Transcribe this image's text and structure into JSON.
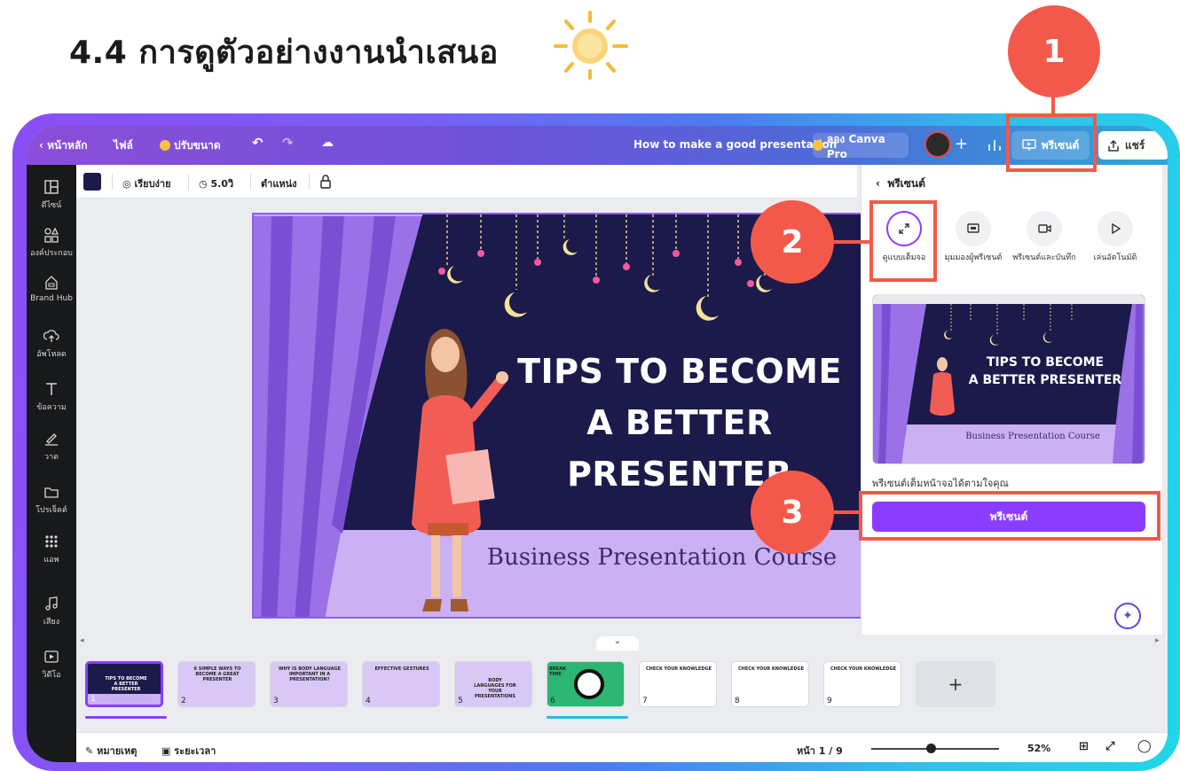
{
  "heading": "4.4  การดูตัวอย่างงานนำเสนอ",
  "callouts": [
    "1",
    "2",
    "3"
  ],
  "topbar": {
    "back": "หน้าหลัก",
    "file": "ไฟล์",
    "resize": "ปรับขนาด",
    "doc_title": "How to make a good presentation",
    "pro": "ลอง Canva Pro",
    "present": "พรีเซนต์",
    "share": "แชร์"
  },
  "sidebar": [
    "ดีไซน์",
    "องค์ประกอบ",
    "Brand Hub",
    "อัพโหลด",
    "ข้อความ",
    "วาด",
    "โปรเจ็คต์",
    "แอพ",
    "เสียง",
    "วิดีโอ"
  ],
  "toolbar": {
    "easy": "เรียบง่าย",
    "duration": "5.0วิ",
    "position": "ตำแหน่ง"
  },
  "slide": {
    "title_line1": "TIPS TO BECOME",
    "title_line2": "A BETTER PRESENTER",
    "subtitle": "Business Presentation Course"
  },
  "panel": {
    "back_title": "พรีเซนต์",
    "options": [
      {
        "label": "ดูแบบเต็มจอ",
        "icon": "expand-icon",
        "selected": true
      },
      {
        "label": "มุมมองผู้พรีเซนต์",
        "icon": "presenter-view-icon",
        "selected": false
      },
      {
        "label": "พรีเซนต์และบันทึก",
        "icon": "record-icon",
        "selected": false
      },
      {
        "label": "เล่นอัตโนมัติ",
        "icon": "play-icon",
        "selected": false
      }
    ],
    "thumb_title1": "TIPS TO BECOME",
    "thumb_title2": "A BETTER PRESENTER",
    "thumb_sub": "Business Presentation Course",
    "note": "พรีเซนต์เต็มหน้าจอได้ตามใจคุณ",
    "button": "พรีเซนต์"
  },
  "pages": [
    {
      "num": "1",
      "label": ""
    },
    {
      "num": "2",
      "label": "6 SIMPLE WAYS TO BECOME A GREAT PRESENTER"
    },
    {
      "num": "3",
      "label": "WHY IS BODY LANGUAGE IMPORTANT IN A PRESENTATION?"
    },
    {
      "num": "4",
      "label": "EFFECTIVE GESTURES"
    },
    {
      "num": "5",
      "label": "BODY LANGUAGES FOR YOUR PRESENTATIONS"
    },
    {
      "num": "6",
      "label": "BREAK TIME"
    },
    {
      "num": "7",
      "label": "CHECK YOUR KNOWLEDGE"
    },
    {
      "num": "8",
      "label": "CHECK YOUR KNOWLEDGE"
    },
    {
      "num": "9",
      "label": "CHECK YOUR KNOWLEDGE"
    }
  ],
  "add_page": "+",
  "statusbar": {
    "notes": "หมายเหตุ",
    "timer": "ระยะเวลา",
    "page": "หน้า 1 / 9",
    "zoom": "52%"
  },
  "colors": {
    "accent": "#8b3dff",
    "callout": "#f3594a",
    "slide_bg": "#1c1a4a",
    "stage": "#cbb0f3"
  }
}
